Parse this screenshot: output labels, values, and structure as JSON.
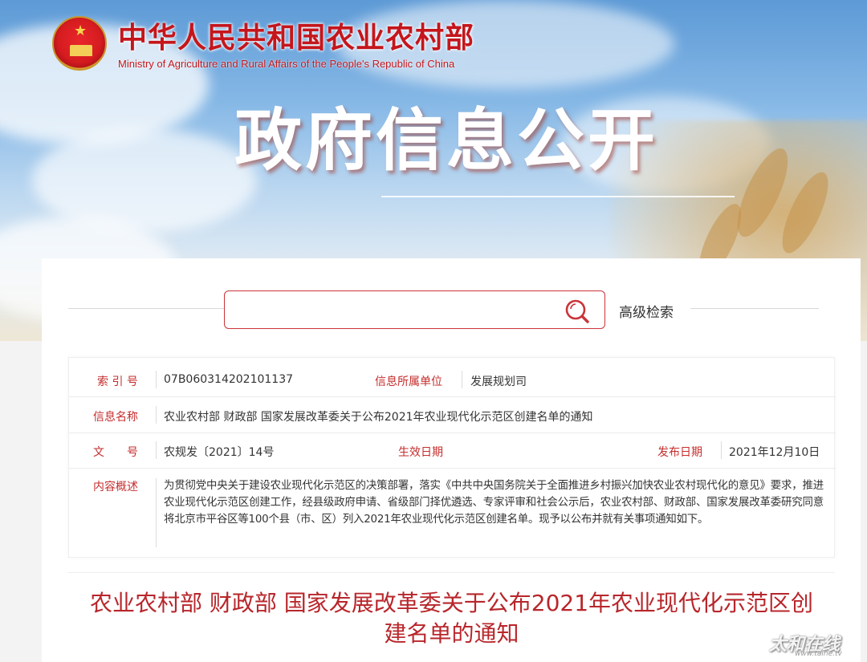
{
  "header": {
    "ministry_cn": "中华人民共和国农业农村部",
    "ministry_en": "Ministry of Agriculture and Rural Affairs of the People's Republic of China",
    "banner_title": "政府信息公开"
  },
  "search": {
    "placeholder": "",
    "advanced_label": "高级检索"
  },
  "info": {
    "index_label": "索 引 号",
    "index_value": "07B060314202101137",
    "unit_label": "信息所属单位",
    "unit_value": "发展规划司",
    "name_label": "信息名称",
    "name_value": "农业农村部 财政部 国家发展改革委关于公布2021年农业现代化示范区创建名单的通知",
    "doc_no_label": "文　　号",
    "doc_no_value": "农规发〔2021〕14号",
    "effective_label": "生效日期",
    "effective_value": "",
    "publish_label": "发布日期",
    "publish_value": "2021年12月10日",
    "summary_label": "内容概述",
    "summary_value": "为贯彻党中央关于建设农业现代化示范区的决策部署，落实《中共中央国务院关于全面推进乡村振兴加快农业农村现代化的意见》要求，推进农业现代化示范区创建工作，经县级政府申请、省级部门择优遴选、专家评审和社会公示后，农业农村部、财政部、国家发展改革委研究同意将北京市平谷区等100个县（市、区）列入2021年农业现代化示范区创建名单。现予以公布并就有关事项通知如下。"
  },
  "document": {
    "title": "农业农村部 财政部 国家发展改革委关于公布2021年农业现代化示范区创建名单的通知"
  },
  "watermark": "太和在线",
  "watermark_url": "www.taihe.tv",
  "colors": {
    "accent_red": "#c4161c",
    "label_red": "#c62d2d"
  }
}
